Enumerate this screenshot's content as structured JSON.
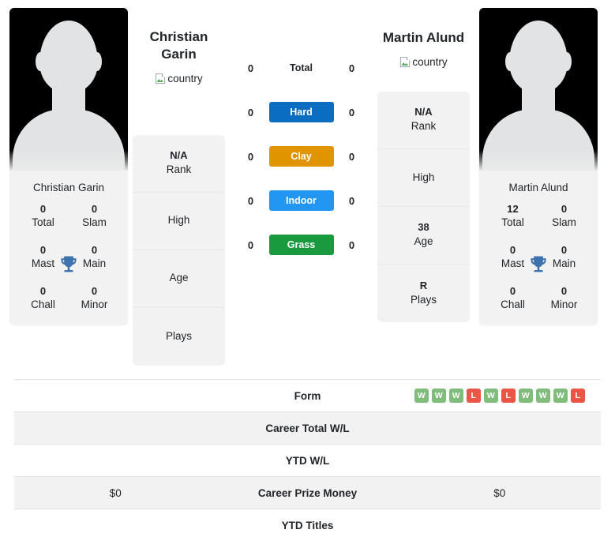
{
  "players": {
    "left": {
      "display_name": "Christian Garin",
      "card_name": "Christian Garin",
      "flag_alt": "country",
      "titles": [
        {
          "value": "0",
          "label": "Total"
        },
        {
          "value": "0",
          "label": "Slam"
        },
        {
          "value": "0",
          "label": "Mast"
        },
        {
          "value": "0",
          "label": "Main"
        },
        {
          "value": "0",
          "label": "Chall"
        },
        {
          "value": "0",
          "label": "Minor"
        }
      ],
      "info": [
        {
          "value": "N/A",
          "label": "Rank"
        },
        {
          "value": "",
          "label": "High"
        },
        {
          "value": "",
          "label": "Age"
        },
        {
          "value": "",
          "label": "Plays"
        }
      ]
    },
    "right": {
      "display_name": "Martin Alund",
      "card_name": "Martin Alund",
      "flag_alt": "country",
      "titles": [
        {
          "value": "12",
          "label": "Total"
        },
        {
          "value": "0",
          "label": "Slam"
        },
        {
          "value": "0",
          "label": "Mast"
        },
        {
          "value": "0",
          "label": "Main"
        },
        {
          "value": "0",
          "label": "Chall"
        },
        {
          "value": "0",
          "label": "Minor"
        }
      ],
      "info": [
        {
          "value": "N/A",
          "label": "Rank"
        },
        {
          "value": "",
          "label": "High"
        },
        {
          "value": "38",
          "label": "Age"
        },
        {
          "value": "R",
          "label": "Plays"
        }
      ]
    }
  },
  "surfaces": [
    {
      "label": "Total",
      "left": "0",
      "right": "0",
      "color": "transparent",
      "plain": true
    },
    {
      "label": "Hard",
      "left": "0",
      "right": "0",
      "color": "#0b6dc0",
      "plain": false
    },
    {
      "label": "Clay",
      "left": "0",
      "right": "0",
      "color": "#e09400",
      "plain": false
    },
    {
      "label": "Indoor",
      "left": "0",
      "right": "0",
      "color": "#2196f3",
      "plain": false
    },
    {
      "label": "Grass",
      "left": "0",
      "right": "0",
      "color": "#199a3f",
      "plain": false
    }
  ],
  "table": {
    "rows": [
      {
        "label": "Form",
        "left": "",
        "right": "",
        "type": "form"
      },
      {
        "label": "Career Total W/L",
        "left": "",
        "right": "",
        "type": "text"
      },
      {
        "label": "YTD W/L",
        "left": "",
        "right": "",
        "type": "text"
      },
      {
        "label": "Career Prize Money",
        "left": "$0",
        "right": "$0",
        "type": "text"
      },
      {
        "label": "YTD Titles",
        "left": "",
        "right": "",
        "type": "text"
      }
    ],
    "form": [
      "W",
      "W",
      "W",
      "L",
      "W",
      "L",
      "W",
      "W",
      "W",
      "L"
    ]
  },
  "colors": {
    "win": "#80bd7c",
    "loss": "#ea5545",
    "trophy": "#3d72ad",
    "card_bg": "#f2f2f2"
  }
}
